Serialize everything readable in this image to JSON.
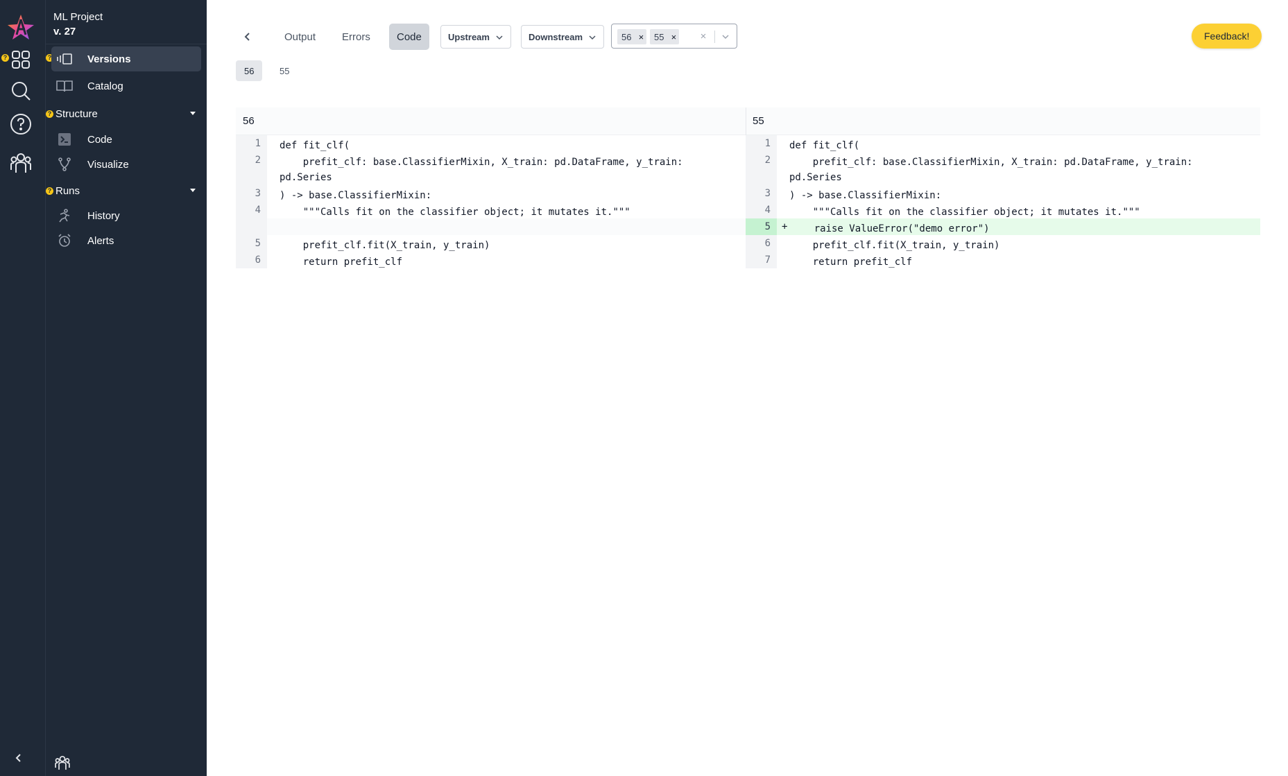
{
  "app": {
    "project_name": "ML Project",
    "version_label": "v. 27",
    "badge": "?"
  },
  "sidebar": {
    "items": [
      {
        "label": "Versions"
      },
      {
        "label": "Catalog"
      },
      {
        "section": "Structure"
      },
      {
        "label": "Code"
      },
      {
        "label": "Visualize"
      },
      {
        "section": "Runs"
      },
      {
        "label": "History"
      },
      {
        "label": "Alerts"
      }
    ]
  },
  "toolbar": {
    "tabs": [
      "Output",
      "Errors",
      "Code"
    ],
    "active_tab": "Code",
    "upstream_label": "Upstream",
    "downstream_label": "Downstream",
    "selected_versions": [
      "56",
      "55"
    ],
    "feedback_label": "Feedback!"
  },
  "version_tabs": [
    "56",
    "55"
  ],
  "diff": {
    "left_title": "56",
    "right_title": "55",
    "left_lines": [
      {
        "num": "1",
        "text": "def fit_clf("
      },
      {
        "num": "2",
        "text": "    prefit_clf: base.ClassifierMixin, X_train: pd.DataFrame, y_train:\npd.Series"
      },
      {
        "num": "3",
        "text": ") -> base.ClassifierMixin:"
      },
      {
        "num": "4",
        "text": "    \"\"\"Calls fit on the classifier object; it mutates it.\"\"\""
      },
      {
        "num": "",
        "text": ""
      },
      {
        "num": "5",
        "text": "    prefit_clf.fit(X_train, y_train)"
      },
      {
        "num": "6",
        "text": "    return prefit_clf"
      }
    ],
    "right_lines": [
      {
        "num": "1",
        "text": "def fit_clf("
      },
      {
        "num": "2",
        "text": "    prefit_clf: base.ClassifierMixin, X_train: pd.DataFrame, y_train:\npd.Series"
      },
      {
        "num": "3",
        "text": ") -> base.ClassifierMixin:"
      },
      {
        "num": "4",
        "text": "    \"\"\"Calls fit on the classifier object; it mutates it.\"\"\""
      },
      {
        "num": "5",
        "text": "    raise ValueError(\"demo error\")",
        "marker": "+"
      },
      {
        "num": "6",
        "text": "    prefit_clf.fit(X_train, y_train)"
      },
      {
        "num": "7",
        "text": "    return prefit_clf"
      }
    ]
  },
  "colors": {
    "sidebar_bg": "#1f2937",
    "accent_yellow": "#fcd034",
    "added_line": "#e6fbea"
  }
}
